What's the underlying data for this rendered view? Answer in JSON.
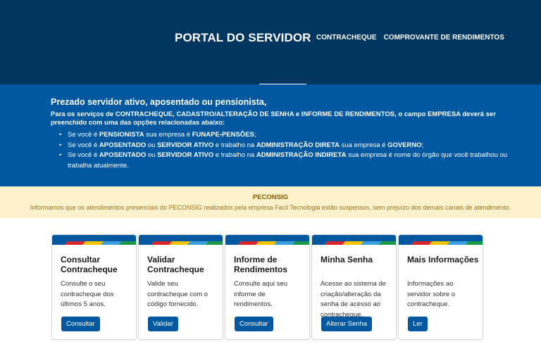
{
  "header": {
    "title": "PORTAL DO SERVIDOR",
    "nav": [
      "CONTRACHEQUE",
      "COMPROVANTE DE RENDIMENTOS"
    ]
  },
  "info": {
    "greeting": "Prezado servidor ativo, aposentado ou pensionista,",
    "intro_parts": [
      {
        "t": "Para os serviços de ",
        "b": false
      },
      {
        "t": "CONTRACHEQUE, CADASTRO/ALTERAÇÃO DE SENHA",
        "b": true
      },
      {
        "t": " e ",
        "b": false
      },
      {
        "t": "INFORME DE RENDIMENTOS",
        "b": true
      },
      {
        "t": ", o campo ",
        "b": false
      },
      {
        "t": "EMPRESA",
        "b": true
      },
      {
        "t": " deverá ser preenchido com uma das opções relacionadas abaixo:",
        "b": false
      }
    ],
    "bullets": [
      [
        {
          "t": "Se você é ",
          "b": false
        },
        {
          "t": "PENSIONISTA",
          "b": true
        },
        {
          "t": " sua empresa é ",
          "b": false
        },
        {
          "t": "FUNAPE-PENSÕES",
          "b": true
        },
        {
          "t": ";",
          "b": false
        }
      ],
      [
        {
          "t": "Se você é ",
          "b": false
        },
        {
          "t": "APOSENTADO",
          "b": true
        },
        {
          "t": " ou ",
          "b": false
        },
        {
          "t": "SERVIDOR ATIVO",
          "b": true
        },
        {
          "t": " e trabalho na ",
          "b": false
        },
        {
          "t": "ADMINISTRAÇÃO DIRETA",
          "b": true
        },
        {
          "t": " sua empresa é ",
          "b": false
        },
        {
          "t": "GOVERNO",
          "b": true
        },
        {
          "t": ";",
          "b": false
        }
      ],
      [
        {
          "t": "Se você é ",
          "b": false
        },
        {
          "t": "APOSENTADO",
          "b": true
        },
        {
          "t": " ou ",
          "b": false
        },
        {
          "t": "SERVIDOR ATIVO",
          "b": true
        },
        {
          "t": " e trabalho na ",
          "b": false
        },
        {
          "t": "ADMINISTRAÇÃO INDIRETA",
          "b": true
        },
        {
          "t": " sua empresa é nome do órgão que você trabalhou ou trabalha atualmente.",
          "b": false
        }
      ]
    ]
  },
  "notice": {
    "title": "PECONSIG",
    "text": "Informamos que os atendimentos presenciais do PECONSIG realizados pela empresa Facil Tecnologia estão suspensos, sem prejuízo dos demais canais de atendimento."
  },
  "band_colors": [
    "#0059a0",
    "#d9242b",
    "#f2c500",
    "#3aa0e0",
    "#1a9a48"
  ],
  "cards": [
    {
      "title": "Consultar Contracheque",
      "text": "Consulte o seu contracheque dos últimos 5 anos.",
      "button": "Consultar"
    },
    {
      "title": "Validar Contracheque",
      "text": "Valide seu contracheque com o código fornecido.",
      "button": "Validar"
    },
    {
      "title": "Informe de Rendimentos",
      "text": "Consulte aqui seu informe de rendimentos.",
      "button": "Consultar"
    },
    {
      "title": "Minha Senha",
      "text": "Acesse ao sistema de criação/alteração da senha de acesso ao contracheque.",
      "button": "Alterar Senha"
    },
    {
      "title": "Mais Informações",
      "text": "Informações ao servidor sobre o contracheque.",
      "button": "Ler"
    }
  ],
  "colors": {
    "header_bg": "#00365f",
    "info_bg": "#0059a0",
    "notice_bg": "#fdf2cc",
    "button_bg": "#0059a0"
  }
}
